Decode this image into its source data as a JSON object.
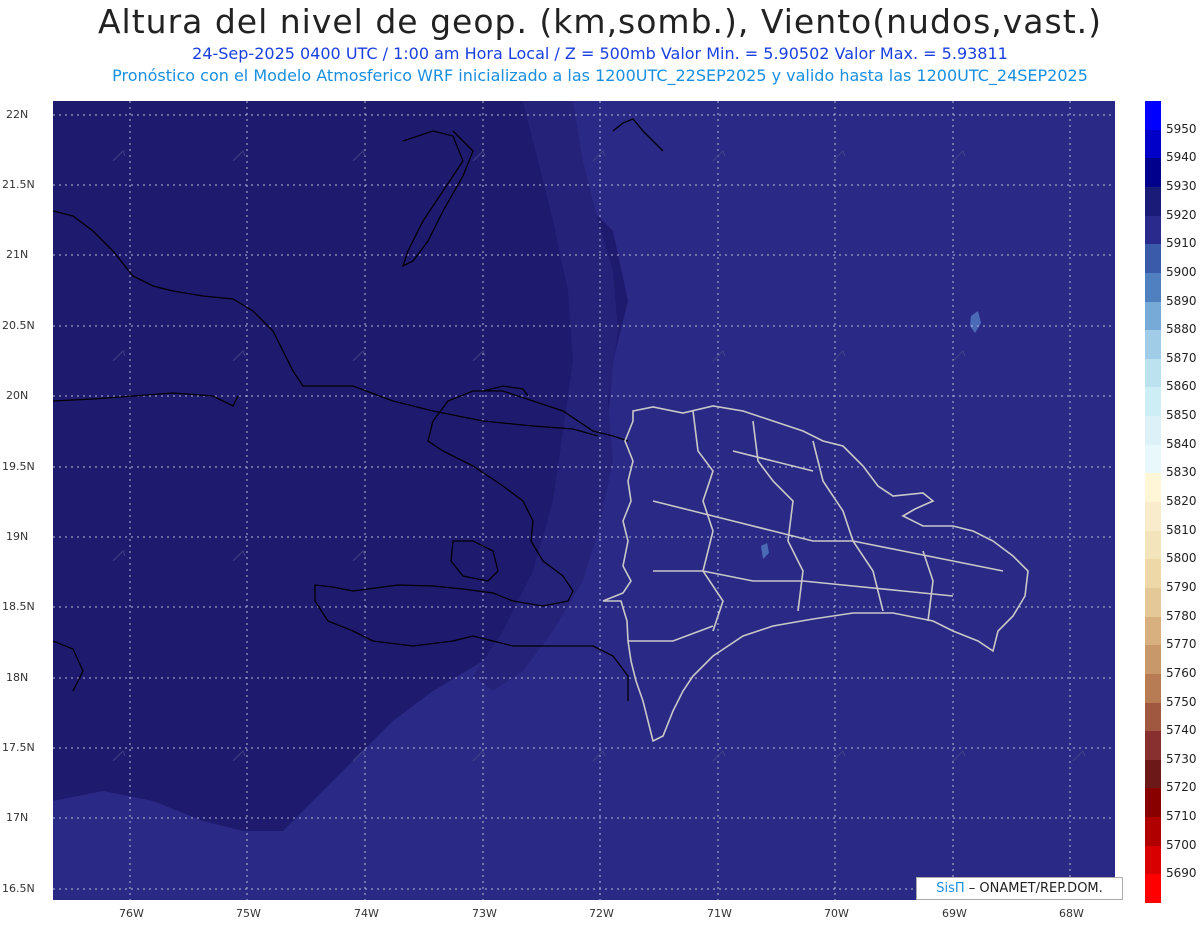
{
  "title": "Altura del nivel de geop. (km,somb.), Viento(nudos,vast.)",
  "subtitle_line1": "24-Sep-2025  0400 UTC / 1:00 am Hora Local / Z = 500mb     Valor Min. = 5.90502  Valor Max. = 5.93811",
  "subtitle_line2": "Pronóstico con el Modelo Atmosferico WRF inicializado a las 1200UTC_22SEP2025 y valido hasta las  1200UTC_24SEP2025",
  "lat_labels": [
    "22N",
    "21.5N",
    "21N",
    "20.5N",
    "20N",
    "19.5N",
    "19N",
    "18.5N",
    "18N",
    "17.5N",
    "17N",
    "16.5N"
  ],
  "lon_labels": [
    "76W",
    "75W",
    "74W",
    "73W",
    "72W",
    "71W",
    "70W",
    "69W",
    "68W"
  ],
  "colorbar": {
    "labels": [
      "5950",
      "5940",
      "5930",
      "5920",
      "5910",
      "5900",
      "5890",
      "5880",
      "5870",
      "5860",
      "5850",
      "5840",
      "5830",
      "5820",
      "5810",
      "5800",
      "5790",
      "5780",
      "5770",
      "5760",
      "5750",
      "5740",
      "5730",
      "5720",
      "5710",
      "5700",
      "5690"
    ],
    "colors": [
      "#0000ff",
      "#0000c8",
      "#00008c",
      "#1a1a78",
      "#2a2a8c",
      "#3a5aaa",
      "#5080c0",
      "#78aad8",
      "#a0cce8",
      "#bce2f0",
      "#cdeef5",
      "#dcf2f8",
      "#e8f8fb",
      "#fff6d8",
      "#f8eccc",
      "#f4e4bc",
      "#eed8a8",
      "#e4c898",
      "#d8b080",
      "#c8986a",
      "#b87c54",
      "#a05840",
      "#883030",
      "#6c1818",
      "#880000",
      "#b00000",
      "#d80000",
      "#ff0000"
    ],
    "accent_map_west": "#1e1a6e",
    "accent_map_east": "#2a2a86"
  },
  "credit": {
    "brand": "SisΠ",
    "text": " – ONAMET/REP.DOM."
  }
}
